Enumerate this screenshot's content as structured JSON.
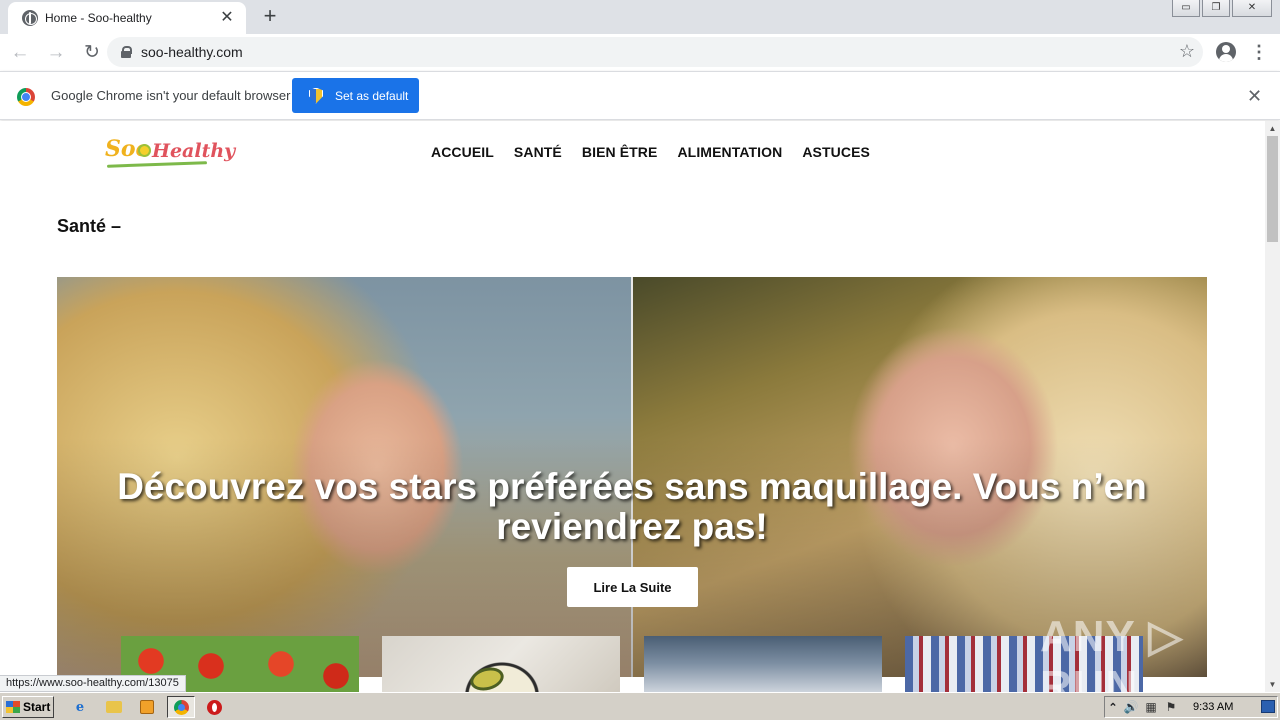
{
  "browser": {
    "tab_title": "Home - Soo-healthy",
    "tab_close_glyph": "✕",
    "new_tab_glyph": "+",
    "url": "soo-healthy.com",
    "status_url": "https://www.soo-healthy.com/13075",
    "window_controls": {
      "minimize": "▭",
      "restore": "❐",
      "close": "✕"
    },
    "nav_glyphs": {
      "back": "←",
      "forward": "→",
      "reload": "↻",
      "star": "☆",
      "menu": "⋮"
    }
  },
  "infobar": {
    "message": "Google Chrome isn't your default browser",
    "button_label": "Set as default",
    "close_glyph": "✕"
  },
  "site": {
    "logo_part1": "Soo",
    "logo_part2": "Healthy",
    "nav": [
      "ACCUEIL",
      "SANTÉ",
      "BIEN ÊTRE",
      "ALIMENTATION",
      "ASTUCES"
    ],
    "section_title": "Santé –",
    "hero": {
      "title": "Découvrez vos stars préférées sans maquillage. Vous n’en reviendrez pas!",
      "button": "Lire La Suite"
    }
  },
  "watermark": "ANY ▷ RUN",
  "taskbar": {
    "start_label": "Start",
    "ie_glyph": "e",
    "tray_arrow": "⌃",
    "tray_sound": "🔊",
    "tray_flag": "⚑",
    "time": "9:33 AM"
  },
  "colors": {
    "accent": "#1a73e8",
    "tab_strip": "#dee1e6",
    "taskbar": "#d4d0c8"
  }
}
